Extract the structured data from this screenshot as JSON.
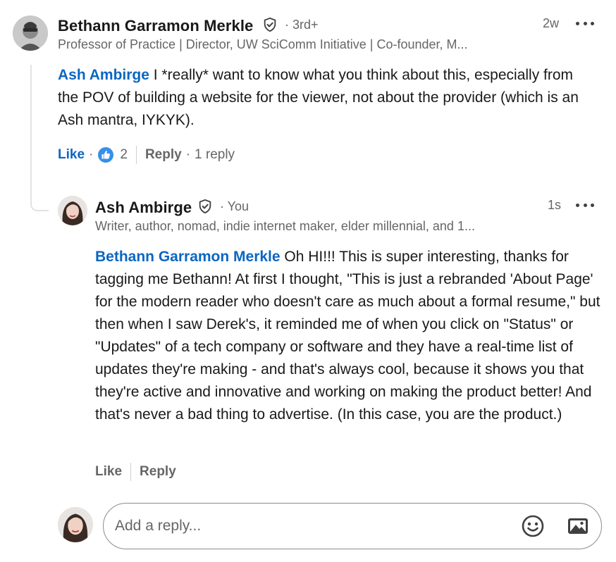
{
  "comment": {
    "author": "Bethann Garramon Merkle",
    "degree": "· 3rd+",
    "headline": "Professor of Practice | Director, UW SciComm Initiative | Co-founder, M...",
    "time": "2w",
    "mention": "Ash Ambirge",
    "text": " I *really* want to know what you think about this, especially from the POV of building a website for the viewer, not about the provider (which is an Ash mantra, IYKYK).",
    "like_label": "Like",
    "reaction_count": "2",
    "reply_label": "Reply",
    "replies_count": "1 reply",
    "reaction_icon": "thumbs-up-icon"
  },
  "reply": {
    "author": "Ash Ambirge",
    "degree": "· You",
    "headline": "Writer, author, nomad, indie internet maker, elder millennial, and 1...",
    "time": "1s",
    "mention": "Bethann Garramon Merkle",
    "text": " Oh HI!!! This is super interesting, thanks for tagging me Bethann! At first I thought, \"This is just a rebranded 'About Page' for the modern reader who doesn't care as much about a formal resume,\" but then when I saw Derek's, it reminded me of when you click on \"Status\" or \"Updates\" of a tech company or software and they have a real-time list of updates they're making - and that's always cool, because it shows you that they're active and innovative and working on making the product better! And that's never a bad thing to advertise. (In this case, you are the product.)",
    "like_label": "Like",
    "reply_label": "Reply"
  },
  "composer": {
    "placeholder": "Add a reply...",
    "emoji_icon": "emoji-icon",
    "image_icon": "image-icon"
  },
  "colors": {
    "link": "#0a66c2",
    "muted": "#666666",
    "text": "#191919"
  }
}
